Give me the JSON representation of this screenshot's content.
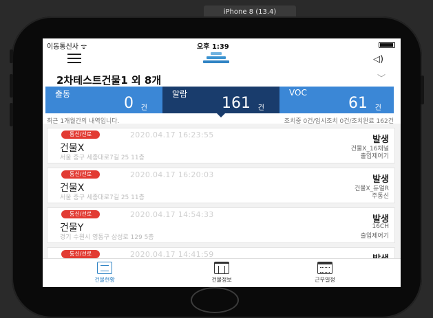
{
  "simulator": {
    "title": "iPhone 8 (13.4)"
  },
  "status_bar": {
    "carrier": "이동통신사 ᯤ",
    "time": "오후 1:39"
  },
  "header": {
    "building_title": "2차테스트건물1 외 8개",
    "chevron": "﹀",
    "speaker": "◁)"
  },
  "summary": {
    "outing": {
      "label": "출동",
      "value": "0",
      "unit": "건"
    },
    "alarm": {
      "label": "알람",
      "value": "161",
      "unit": "건"
    },
    "voc": {
      "label": "VOC",
      "value": "61",
      "unit": "건"
    }
  },
  "notes": {
    "left": "최근 1개월간의 내역입니다.",
    "right": "조치중 0건/임시조치 0건/조치완료 162건"
  },
  "events": [
    {
      "badge": "통신/선로",
      "date": "2020.04.17 16:23:55",
      "building": "건물X",
      "address": "서울 중구 세종대로7길 25 11층",
      "state": "발생",
      "device": "건물X_16채널",
      "detail": "출입제어기"
    },
    {
      "badge": "통신/선로",
      "date": "2020.04.17 16:20:03",
      "building": "건물X",
      "address": "서울 중구 세종대로7길 25 11층",
      "state": "발생",
      "device": "건물X_듀얼R",
      "detail": "주통신"
    },
    {
      "badge": "통신/선로",
      "date": "2020.04.17 14:54:33",
      "building": "건물Y",
      "address": "경기 수원시 영통구 삼성로 129 5층",
      "state": "발생",
      "device": "16CH",
      "detail": "출입제어기"
    },
    {
      "badge": "통신/선로",
      "date": "2020.04.17 14:41:59",
      "building": "",
      "address": "",
      "state": "발생",
      "device": "",
      "detail": ""
    }
  ],
  "tabs": [
    {
      "label": "건물현황",
      "icon": "list-icon",
      "active": true
    },
    {
      "label": "건물정보",
      "icon": "building-icon",
      "active": false
    },
    {
      "label": "근무일정",
      "icon": "calendar-icon",
      "active": false
    }
  ],
  "colors": {
    "accent": "#3b87d6",
    "dark_accent": "#193c6c",
    "badge": "#e23b33"
  }
}
